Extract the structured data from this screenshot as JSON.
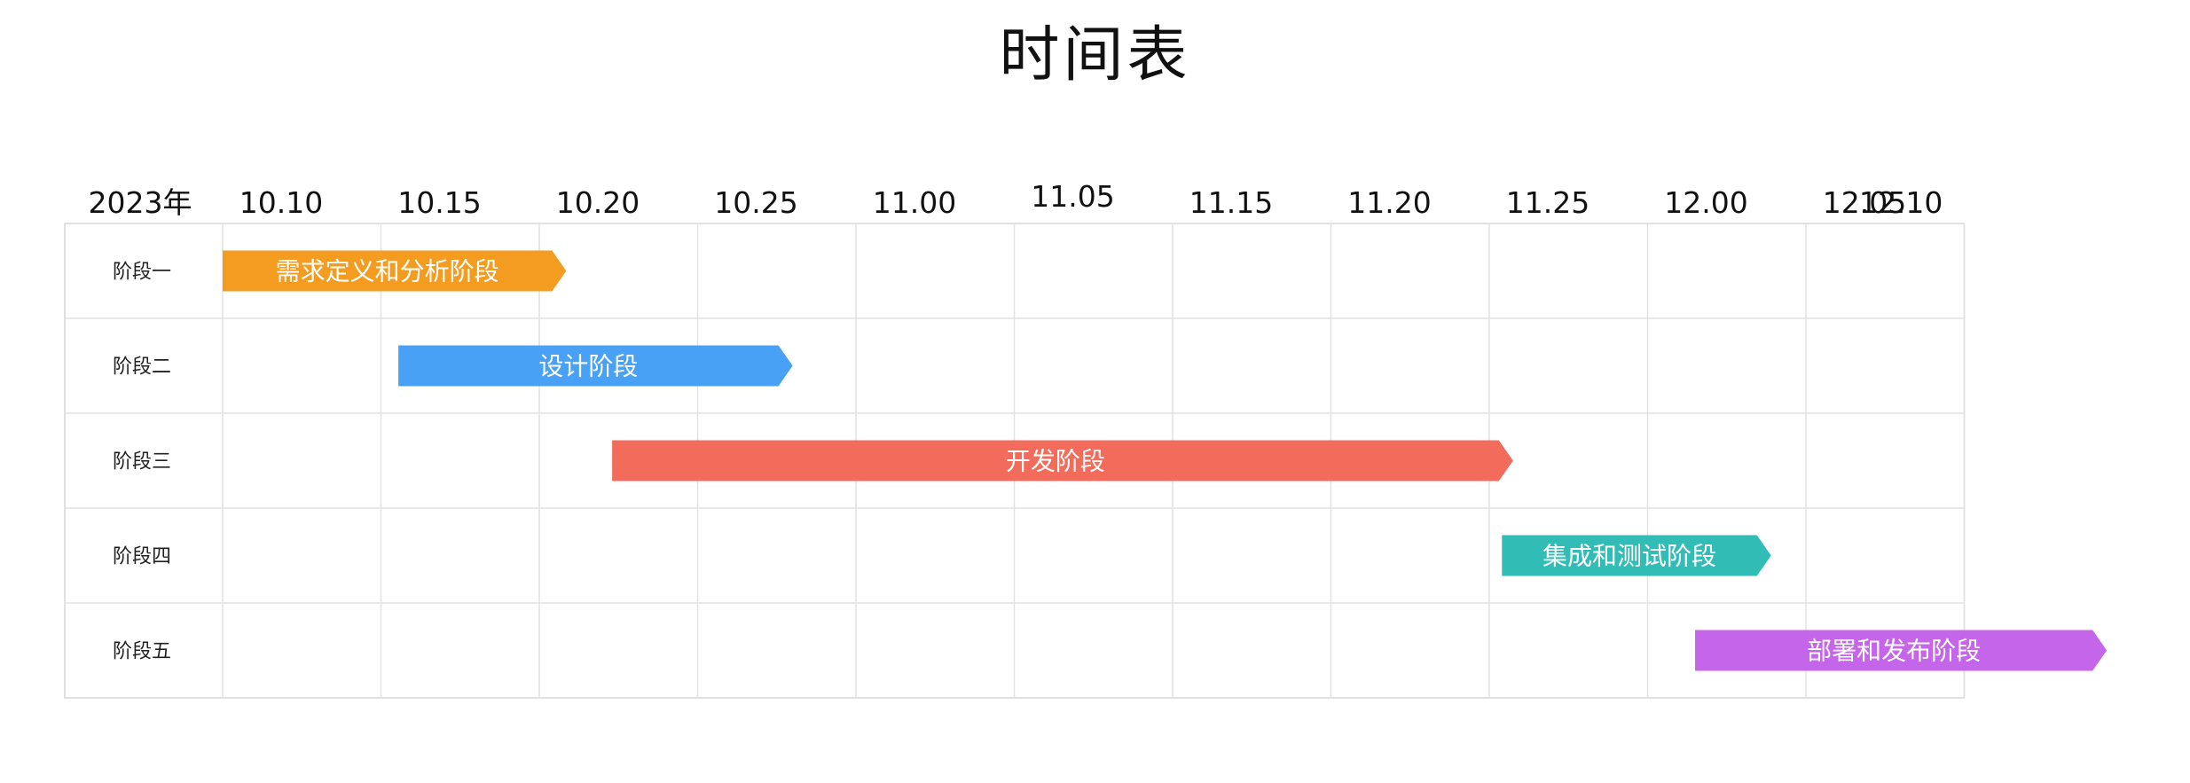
{
  "title": "时间表",
  "year_label": "2023年",
  "dates": [
    "10.10",
    "10.15",
    "10.20",
    "10.25",
    "11.00",
    "11.05",
    "11.15",
    "11.20",
    "11.25",
    "12.00",
    "12.05",
    "12.10"
  ],
  "rows": [
    {
      "label": "阶段一",
      "bar": {
        "label": "需求定义和分析阶段",
        "color": "#F39C1F",
        "start": 0.0,
        "end": 2.17
      }
    },
    {
      "label": "阶段二",
      "bar": {
        "label": "设计阶段",
        "color": "#49A1F5",
        "start": 1.11,
        "end": 3.6
      }
    },
    {
      "label": "阶段三",
      "bar": {
        "label": "开发阶段",
        "color": "#F26B5B",
        "start": 2.46,
        "end": 8.15
      }
    },
    {
      "label": "阶段四",
      "bar": {
        "label": "集成和测试阶段",
        "color": "#31BDB6",
        "start": 8.08,
        "end": 9.78
      }
    },
    {
      "label": "阶段五",
      "bar": {
        "label": "部署和发布阶段",
        "color": "#C565EA",
        "start": 9.3,
        "end": 11.9
      }
    }
  ],
  "colors": {
    "grid": "#E2E2E2",
    "border": "#D6D6D6"
  }
}
